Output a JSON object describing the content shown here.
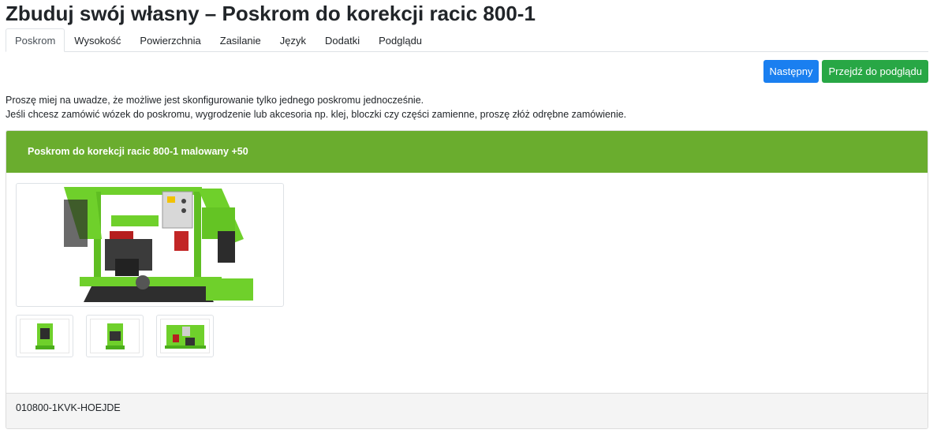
{
  "page": {
    "title": "Zbuduj swój własny – Poskrom do korekcji racic 800-1"
  },
  "tabs": [
    {
      "label": "Poskrom",
      "active": true
    },
    {
      "label": "Wysokość",
      "active": false
    },
    {
      "label": "Powierzchnia",
      "active": false
    },
    {
      "label": "Zasilanie",
      "active": false
    },
    {
      "label": "Język",
      "active": false
    },
    {
      "label": "Dodatki",
      "active": false
    },
    {
      "label": "Podglądu",
      "active": false
    }
  ],
  "toolbar": {
    "next_label": "Następny",
    "preview_label": "Przejdź do podglądu"
  },
  "notice": {
    "line1": "Proszę miej na uwadze, że możliwe jest skonfigurowanie tylko jednego poskromu jednocześnie.",
    "line2": "Jeśli chcesz zamówić wózek do poskromu, wygrodzenie lub akcesoria np. klej, bloczki czy części zamienne, proszę złóż odrębne zamówienie."
  },
  "product": {
    "header": "Poskrom do korekcji racic 800-1 malowany +50",
    "sku": "010800-1KVK-HOEJDE",
    "thumbnails": [
      "product-photo-front",
      "product-photo-back",
      "product-photo-side"
    ]
  },
  "colors": {
    "primary": "#1a7ff0",
    "success": "#28a745",
    "header_green": "#6aad2e",
    "machine_green": "#6fd02b"
  }
}
